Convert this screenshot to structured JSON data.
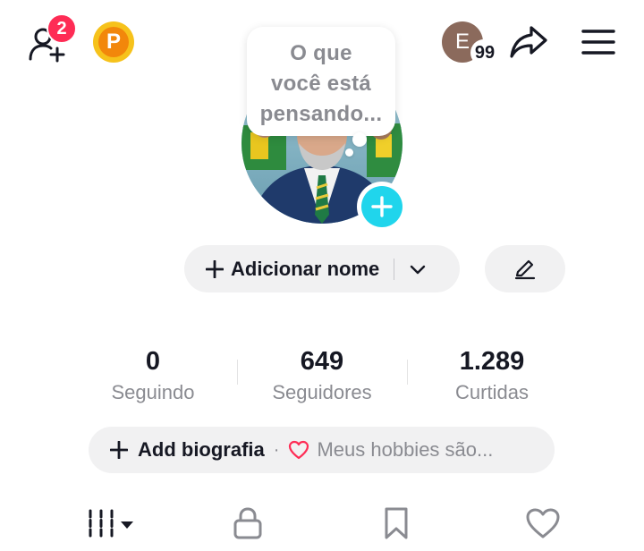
{
  "header": {
    "friend_requests_badge": "2",
    "points_letter": "P",
    "account_initial": "E",
    "account_count": "99",
    "icons": [
      "add-friend-icon",
      "points-icon",
      "share-icon",
      "menu-icon"
    ]
  },
  "profile": {
    "bubble_lines": [
      "O que",
      "você está",
      "pensando..."
    ],
    "add_name_label": "Adicionar nome",
    "icons": [
      "plus-icon",
      "chevron-down-icon",
      "pencil-icon"
    ]
  },
  "stats": [
    {
      "value": "0",
      "label": "Seguindo"
    },
    {
      "value": "649",
      "label": "Seguidores"
    },
    {
      "value": "1.289",
      "label": "Curtidas"
    }
  ],
  "bio": {
    "add_label": "Add biografia",
    "separator": "·",
    "hobbies_prompt": "Meus hobbies são..."
  },
  "tabs": [
    "videos-grid-icon",
    "lock-icon",
    "bookmark-icon",
    "heart-icon"
  ],
  "colors": {
    "accent_red": "#fe2c55",
    "accent_cyan": "#20d5ec",
    "points_yellow": "#f6c21b",
    "points_orange": "#f2870b",
    "pill_bg": "#f1f1f2",
    "secondary_text": "#8a8b91"
  }
}
